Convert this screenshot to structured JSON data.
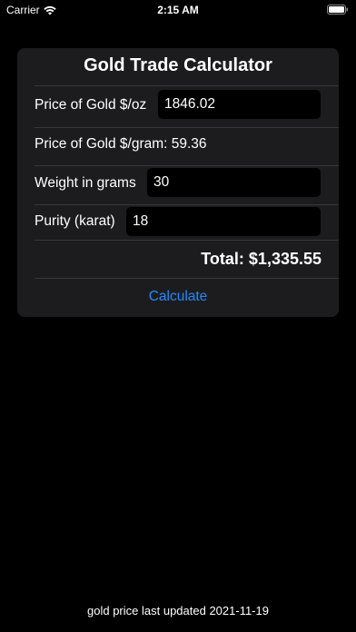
{
  "status_bar": {
    "carrier": "Carrier",
    "time": "2:15 AM"
  },
  "card": {
    "title": "Gold Trade Calculator",
    "price_per_oz_label": "Price of Gold $/oz",
    "price_per_oz_value": "1846.02",
    "price_per_gram_text": "Price of Gold $/gram: 59.36",
    "weight_label": "Weight in grams",
    "weight_value": "30",
    "purity_label": "Purity (karat)",
    "purity_value": "18",
    "total_text": "Total: $1,335.55",
    "calculate_label": "Calculate"
  },
  "footer": {
    "updated_text": "gold price last updated 2021-11-19"
  },
  "colors": {
    "background": "#000000",
    "card": "#1c1c1e",
    "accent": "#1e8bff",
    "input_bg": "#000000"
  },
  "icons": {
    "wifi": "wifi-icon",
    "battery": "battery-icon"
  }
}
